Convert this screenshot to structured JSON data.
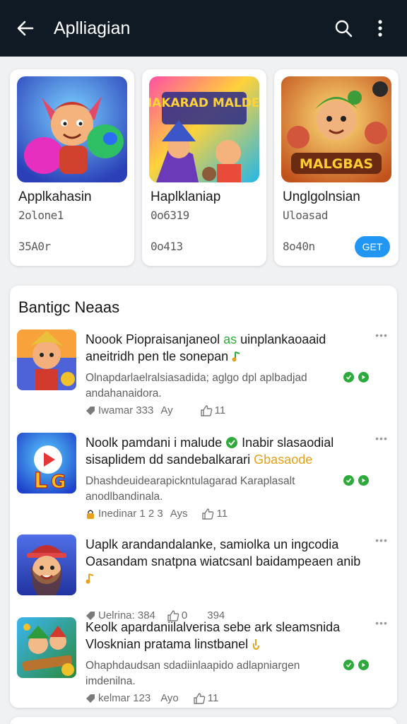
{
  "appbar": {
    "title": "Aplliagian",
    "back_icon": "arrow-left-icon",
    "search_icon": "search-icon",
    "menu_icon": "more-vertical-icon"
  },
  "featured": [
    {
      "name": "Applkahasin",
      "sub": "2olone1",
      "count": "35A0r",
      "button": ""
    },
    {
      "name": "Haplklaniap",
      "sub": "0o6319",
      "count": "0o413",
      "button": ""
    },
    {
      "name": "Unglgolnsian",
      "sub": "Uloasad",
      "count": "8o40n",
      "button": "GET"
    }
  ],
  "featured_art": [
    {
      "banner": ""
    },
    {
      "banner": "MAKARAD MALDES"
    },
    {
      "banner": "MALGBAS"
    }
  ],
  "news": {
    "title": "Bantigc Neaas",
    "items": [
      {
        "headline": "Noook Piopraisanjaneol",
        "headline_green": "as",
        "headline_tail": "uinplankaoaaid aneitridh pen tle sonepan",
        "desc": "Olnapdarlaelralsiasadida; aglgo dpl aplbadjad andahanaidora.",
        "meta_views": "Iwamar 333",
        "meta_time": "Ay",
        "meta_likes": "11"
      },
      {
        "headline": "Noolk pamdani i malude",
        "headline_mid": "Inabir slasaodial sisaplidem dd sandebalkarari",
        "headline_orange": "Gbasaode",
        "desc": "Dhashdeuidearapickntulagarad Karaplasalt anodlbandinala.",
        "meta_views": "Inedinar 1 2 3",
        "meta_time": "Ays",
        "meta_likes": "11"
      },
      {
        "headline": "Uaplk arandandalanke, samiolka un ingcodia Oasandam snatpna wiatcsanl baidampeaen anib",
        "desc": "",
        "meta_views": "Uelrina: 384",
        "meta_time": "",
        "meta_likes": "0",
        "meta_extra": "394"
      },
      {
        "headline": "Keolk apardaniilalverisa sebe ark sleamsnida Vlosknian pratama linstbanel",
        "desc": "Ohaphdaudsan sdadiinlaapido adlapniargen imdenilna.",
        "meta_views": "kelmar 123",
        "meta_time": "Ayo",
        "meta_likes": "11"
      }
    ]
  },
  "colors": {
    "appbar_bg": "#0f1a24",
    "accent_blue": "#2196f3",
    "accent_green": "#2eaa3c",
    "accent_orange": "#e7a11b"
  }
}
